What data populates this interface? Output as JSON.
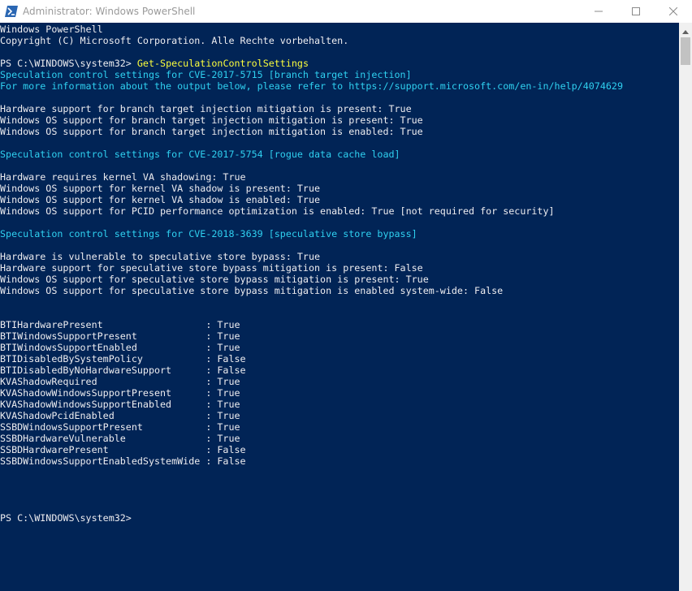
{
  "window": {
    "title": "Administrator: Windows PowerShell",
    "icon": "powershell-icon",
    "controls": {
      "minimize": "minimize-icon",
      "maximize": "maximize-icon",
      "close": "close-icon"
    }
  },
  "colors": {
    "console_bg": "#012456",
    "default_text": "#eeedf0",
    "accent_text": "#2fd0f0",
    "command_text": "#fdfd3c"
  },
  "console": {
    "lines": [
      {
        "segments": [
          {
            "text": "Windows PowerShell",
            "color": "white"
          }
        ]
      },
      {
        "segments": [
          {
            "text": "Copyright (C) Microsoft Corporation. Alle Rechte vorbehalten.",
            "color": "white"
          }
        ]
      },
      {
        "segments": [
          {
            "text": "",
            "color": "white"
          }
        ]
      },
      {
        "segments": [
          {
            "text": "PS C:\\WINDOWS\\system32> ",
            "color": "white"
          },
          {
            "text": "Get-SpeculationControlSettings",
            "color": "yellow"
          }
        ]
      },
      {
        "segments": [
          {
            "text": "Speculation control settings for CVE-2017-5715 [branch target injection]",
            "color": "cyan"
          }
        ]
      },
      {
        "segments": [
          {
            "text": "For more information about the output below, please refer to https://support.microsoft.com/en-in/help/4074629",
            "color": "cyan"
          }
        ]
      },
      {
        "segments": [
          {
            "text": "",
            "color": "white"
          }
        ]
      },
      {
        "segments": [
          {
            "text": "Hardware support for branch target injection mitigation is present: True",
            "color": "white"
          }
        ]
      },
      {
        "segments": [
          {
            "text": "Windows OS support for branch target injection mitigation is present: True",
            "color": "white"
          }
        ]
      },
      {
        "segments": [
          {
            "text": "Windows OS support for branch target injection mitigation is enabled: True",
            "color": "white"
          }
        ]
      },
      {
        "segments": [
          {
            "text": "",
            "color": "white"
          }
        ]
      },
      {
        "segments": [
          {
            "text": "Speculation control settings for CVE-2017-5754 [rogue data cache load]",
            "color": "cyan"
          }
        ]
      },
      {
        "segments": [
          {
            "text": "",
            "color": "white"
          }
        ]
      },
      {
        "segments": [
          {
            "text": "Hardware requires kernel VA shadowing: True",
            "color": "white"
          }
        ]
      },
      {
        "segments": [
          {
            "text": "Windows OS support for kernel VA shadow is present: True",
            "color": "white"
          }
        ]
      },
      {
        "segments": [
          {
            "text": "Windows OS support for kernel VA shadow is enabled: True",
            "color": "white"
          }
        ]
      },
      {
        "segments": [
          {
            "text": "Windows OS support for PCID performance optimization is enabled: True [not required for security]",
            "color": "white"
          }
        ]
      },
      {
        "segments": [
          {
            "text": "",
            "color": "white"
          }
        ]
      },
      {
        "segments": [
          {
            "text": "Speculation control settings for CVE-2018-3639 [speculative store bypass]",
            "color": "cyan"
          }
        ]
      },
      {
        "segments": [
          {
            "text": "",
            "color": "white"
          }
        ]
      },
      {
        "segments": [
          {
            "text": "Hardware is vulnerable to speculative store bypass: True",
            "color": "white"
          }
        ]
      },
      {
        "segments": [
          {
            "text": "Hardware support for speculative store bypass mitigation is present: False",
            "color": "white"
          }
        ]
      },
      {
        "segments": [
          {
            "text": "Windows OS support for speculative store bypass mitigation is present: True",
            "color": "white"
          }
        ]
      },
      {
        "segments": [
          {
            "text": "Windows OS support for speculative store bypass mitigation is enabled system-wide: False",
            "color": "white"
          }
        ]
      },
      {
        "segments": [
          {
            "text": "",
            "color": "white"
          }
        ]
      },
      {
        "segments": [
          {
            "text": "",
            "color": "white"
          }
        ]
      },
      {
        "segments": [
          {
            "text": "BTIHardwarePresent                  : True",
            "color": "white"
          }
        ]
      },
      {
        "segments": [
          {
            "text": "BTIWindowsSupportPresent            : True",
            "color": "white"
          }
        ]
      },
      {
        "segments": [
          {
            "text": "BTIWindowsSupportEnabled            : True",
            "color": "white"
          }
        ]
      },
      {
        "segments": [
          {
            "text": "BTIDisabledBySystemPolicy           : False",
            "color": "white"
          }
        ]
      },
      {
        "segments": [
          {
            "text": "BTIDisabledByNoHardwareSupport      : False",
            "color": "white"
          }
        ]
      },
      {
        "segments": [
          {
            "text": "KVAShadowRequired                   : True",
            "color": "white"
          }
        ]
      },
      {
        "segments": [
          {
            "text": "KVAShadowWindowsSupportPresent      : True",
            "color": "white"
          }
        ]
      },
      {
        "segments": [
          {
            "text": "KVAShadowWindowsSupportEnabled      : True",
            "color": "white"
          }
        ]
      },
      {
        "segments": [
          {
            "text": "KVAShadowPcidEnabled                : True",
            "color": "white"
          }
        ]
      },
      {
        "segments": [
          {
            "text": "SSBDWindowsSupportPresent           : True",
            "color": "white"
          }
        ]
      },
      {
        "segments": [
          {
            "text": "SSBDHardwareVulnerable              : True",
            "color": "white"
          }
        ]
      },
      {
        "segments": [
          {
            "text": "SSBDHardwarePresent                 : False",
            "color": "white"
          }
        ]
      },
      {
        "segments": [
          {
            "text": "SSBDWindowsSupportEnabledSystemWide : False",
            "color": "white"
          }
        ]
      },
      {
        "segments": [
          {
            "text": "",
            "color": "white"
          }
        ]
      },
      {
        "segments": [
          {
            "text": "",
            "color": "white"
          }
        ]
      },
      {
        "segments": [
          {
            "text": "",
            "color": "white"
          }
        ]
      },
      {
        "segments": [
          {
            "text": "",
            "color": "white"
          }
        ]
      },
      {
        "segments": [
          {
            "text": "PS C:\\WINDOWS\\system32> ",
            "color": "white"
          }
        ]
      }
    ]
  },
  "scrollbar": {
    "up_icon": "scroll-up-arrow-icon"
  }
}
